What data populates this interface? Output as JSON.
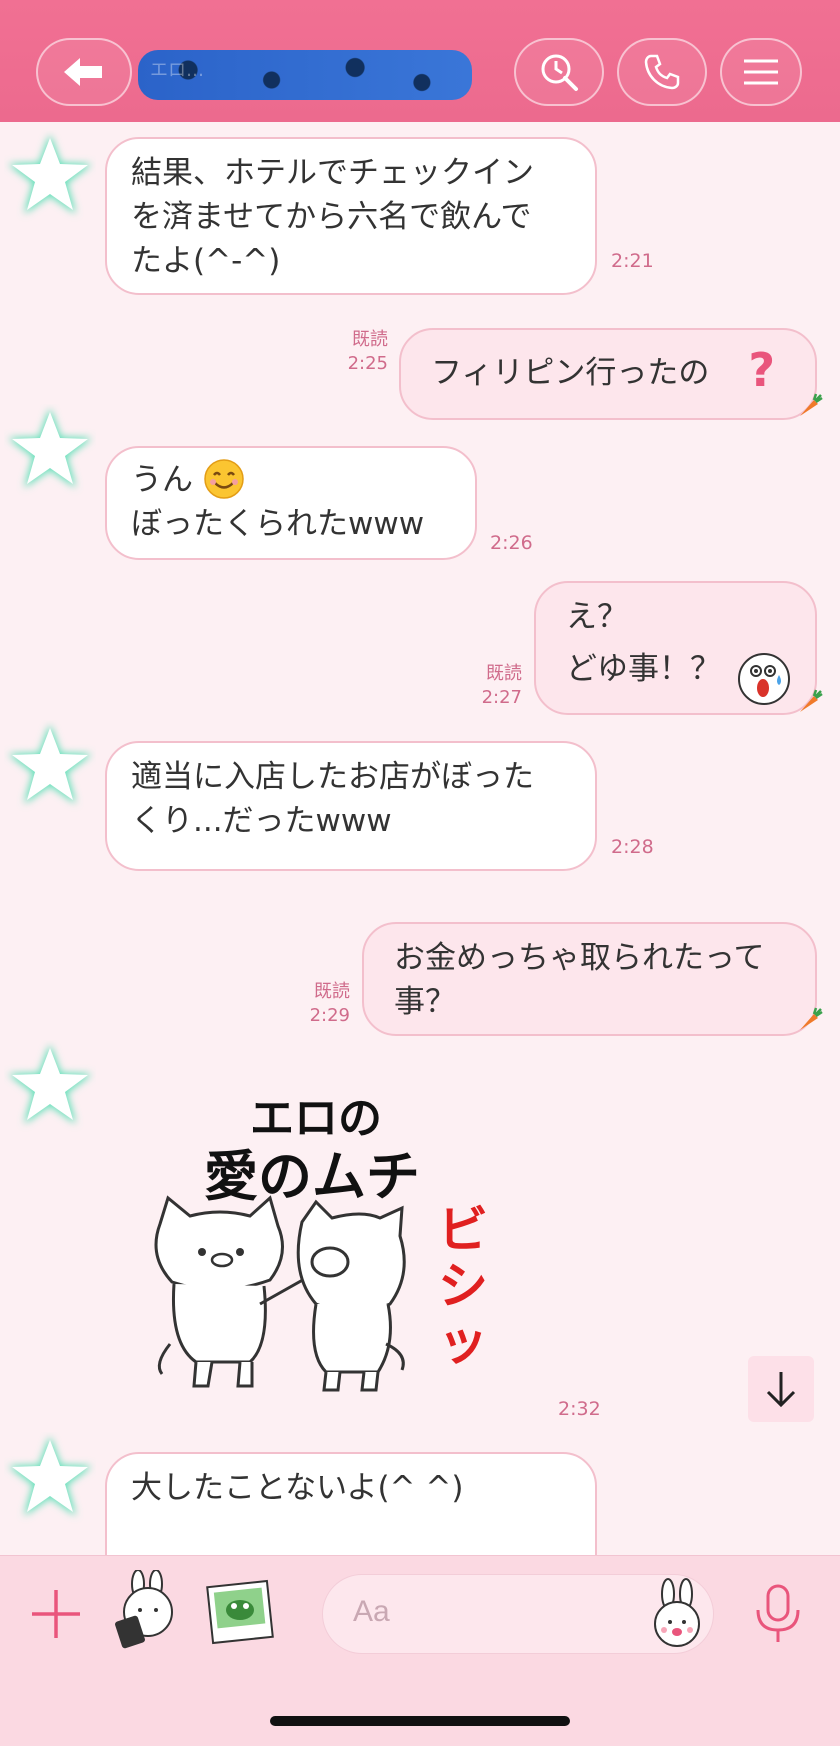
{
  "header": {
    "title": "エロ…"
  },
  "messages": [
    {
      "side": "left",
      "text": "結果、ホテルでチェックイン\nを済ませてから六名で飲んで\nたよ(^-^)",
      "time": "2:21"
    },
    {
      "side": "right",
      "text": "フィリピン行ったの",
      "time": "2:25",
      "read": "既読"
    },
    {
      "side": "left",
      "text": "うん\nぼったくられたwww",
      "time": "2:26"
    },
    {
      "side": "right",
      "text": "え？\nどゆ事！？",
      "time": "2:27",
      "read": "既読"
    },
    {
      "side": "left",
      "text": "適当に入店したお店がぼった\nくり...だったwww",
      "time": "2:28"
    },
    {
      "side": "right",
      "text": "お金めっちゃ取られたって\n事？",
      "time": "2:29",
      "read": "既読"
    },
    {
      "side": "left",
      "sticker_line1": "エロの",
      "sticker_line2": "愛のムチ",
      "sticker_sfx": "ビシッ",
      "time": "2:32"
    },
    {
      "side": "left",
      "text": "大したことないよ(^ ^)"
    }
  ],
  "input": {
    "placeholder": "Aa"
  },
  "colors": {
    "header": "#ec6a8e",
    "accent": "#e9557c",
    "bubble_border": "#f3bfcc"
  }
}
